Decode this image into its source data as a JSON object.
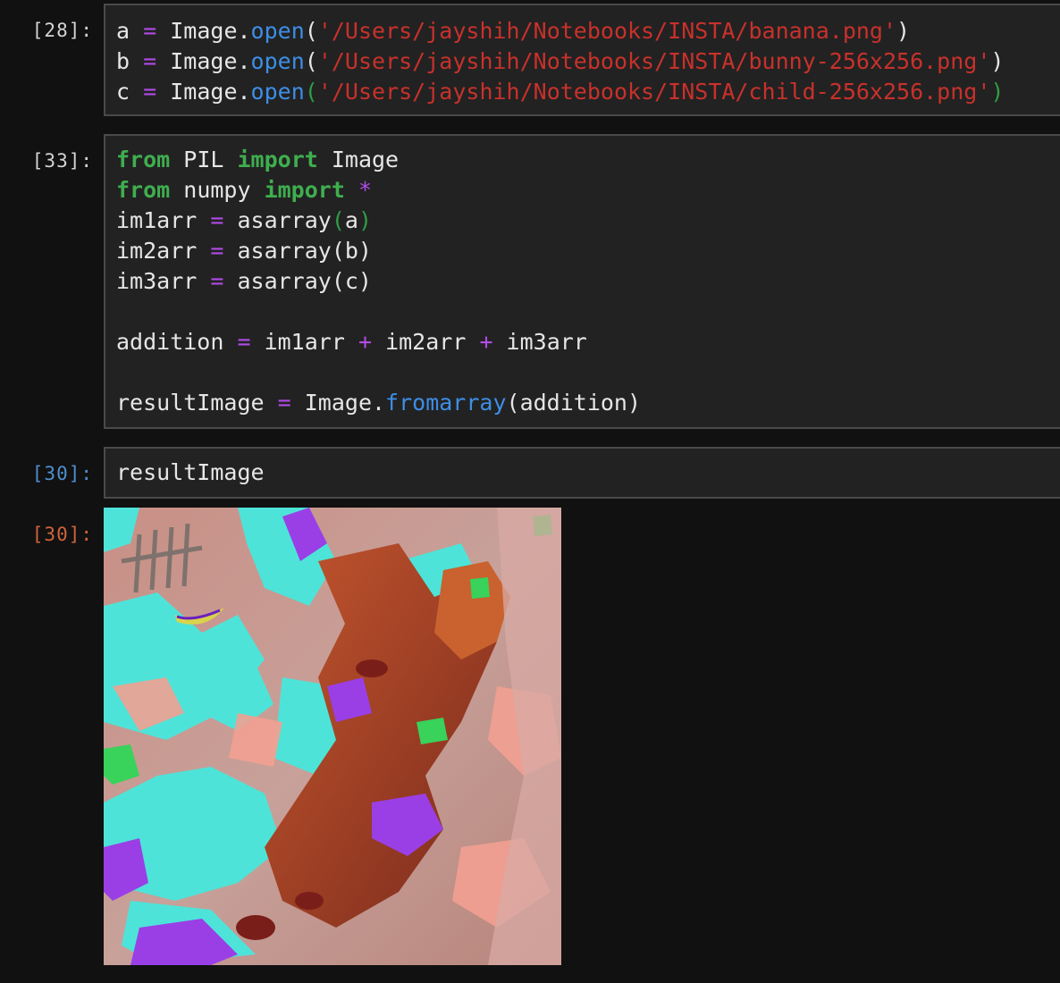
{
  "cells": [
    {
      "prompt": "[28]:",
      "lines": [
        [
          [
            "v",
            "a"
          ],
          [
            "t",
            " "
          ],
          [
            "op",
            "="
          ],
          [
            "t",
            " Image."
          ],
          [
            "fn",
            "open"
          ],
          [
            "t",
            "("
          ],
          [
            "str",
            "'/Users/jayshih/Notebooks/INSTA/banana.png'"
          ],
          [
            "t",
            ")"
          ]
        ],
        [
          [
            "v",
            "b"
          ],
          [
            "t",
            " "
          ],
          [
            "op",
            "="
          ],
          [
            "t",
            " Image."
          ],
          [
            "fn",
            "open"
          ],
          [
            "t",
            "("
          ],
          [
            "str",
            "'/Users/jayshih/Notebooks/INSTA/bunny-256x256.png'"
          ],
          [
            "t",
            ")"
          ]
        ],
        [
          [
            "v",
            "c"
          ],
          [
            "t",
            " "
          ],
          [
            "op",
            "="
          ],
          [
            "t",
            " Image."
          ],
          [
            "fn",
            "open"
          ],
          [
            "pg",
            "("
          ],
          [
            "str",
            "'/Users/jayshih/Notebooks/INSTA/child-256x256.png'"
          ],
          [
            "pg",
            ")"
          ]
        ]
      ]
    },
    {
      "prompt": "[33]:",
      "lines": [
        [
          [
            "kw",
            "from"
          ],
          [
            "t",
            " PIL "
          ],
          [
            "kw",
            "import"
          ],
          [
            "t",
            " Image"
          ]
        ],
        [
          [
            "kw",
            "from"
          ],
          [
            "t",
            " numpy "
          ],
          [
            "kw",
            "import"
          ],
          [
            "t",
            " "
          ],
          [
            "op",
            "*"
          ]
        ],
        [
          [
            "t",
            "im1arr "
          ],
          [
            "op",
            "="
          ],
          [
            "t",
            " asarray"
          ],
          [
            "pg",
            "("
          ],
          [
            "t",
            "a"
          ],
          [
            "pg",
            ")"
          ]
        ],
        [
          [
            "t",
            "im2arr "
          ],
          [
            "op",
            "="
          ],
          [
            "t",
            " asarray(b)"
          ]
        ],
        [
          [
            "t",
            "im3arr "
          ],
          [
            "op",
            "="
          ],
          [
            "t",
            " asarray(c)"
          ]
        ],
        [],
        [
          [
            "t",
            "addition "
          ],
          [
            "op",
            "="
          ],
          [
            "t",
            " im1arr "
          ],
          [
            "op",
            "+"
          ],
          [
            "t",
            " im2arr "
          ],
          [
            "op",
            "+"
          ],
          [
            "t",
            " im3arr"
          ]
        ],
        [],
        [
          [
            "t",
            "resultImage "
          ],
          [
            "op",
            "="
          ],
          [
            "t",
            " Image."
          ],
          [
            "fn",
            "fromarray"
          ],
          [
            "t",
            "(addition)"
          ]
        ]
      ]
    },
    {
      "prompt": "[30]:",
      "lines": [
        [
          [
            "t",
            "resultImage"
          ]
        ]
      ]
    }
  ],
  "output": {
    "prompt": "[30]:"
  },
  "colors": {
    "background": "#111111",
    "cell_background": "#222222",
    "cell_border": "#4a4a4a",
    "keyword": "#3fae4f",
    "operator": "#b14be6",
    "function": "#3d8ee6",
    "string": "#c8312b",
    "prompt_executed": "#d4d4d4",
    "prompt_running": "#4f8fd0",
    "prompt_output": "#d1643a"
  }
}
